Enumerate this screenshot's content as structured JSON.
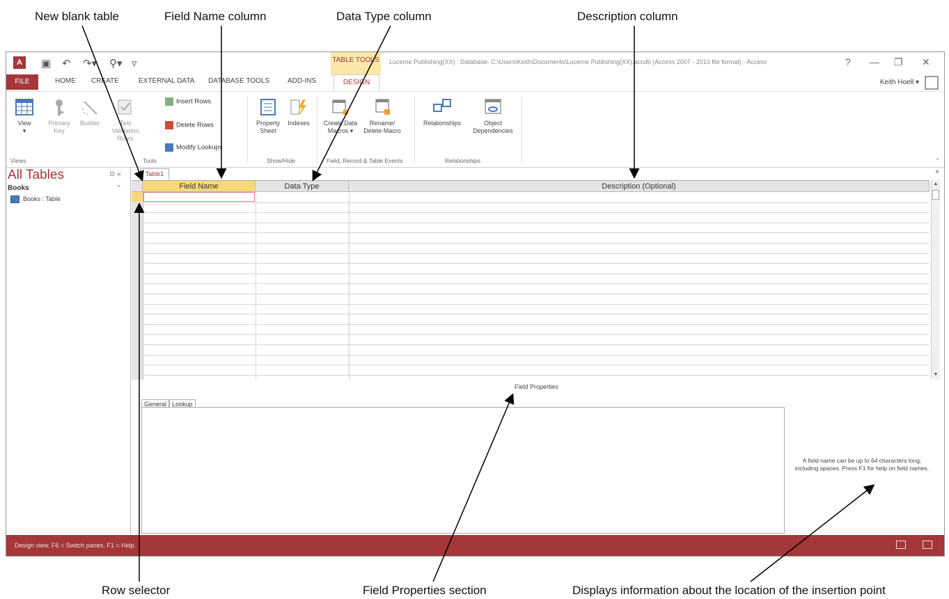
{
  "callouts": {
    "new_blank_table": "New blank table",
    "field_name_column": "Field Name column",
    "data_type_column": "Data Type column",
    "description_column": "Description column",
    "row_selector": "Row selector",
    "field_properties_section": "Field Properties section",
    "insertion_info": "Displays information about the location of the insertion point"
  },
  "window": {
    "table_tools_label": "TABLE TOOLS",
    "title": "Lucerne Publishing(XX) : Database- C:\\Users\\Keith\\Documents\\Lucerne Publishing(XX).accdb (Access 2007 - 2013 file format) - Access",
    "help": "?",
    "user": "Keith Hoell ▾"
  },
  "tabs": [
    "FILE",
    "HOME",
    "CREATE",
    "EXTERNAL DATA",
    "DATABASE TOOLS",
    "ADD-INS",
    "DESIGN"
  ],
  "ribbon": {
    "view": "View",
    "primary_key": "Primary Key",
    "builder": "Builder",
    "test_validation": "Test Validation Rules",
    "insert_rows": "Insert Rows",
    "delete_rows": "Delete Rows",
    "modify_lookups": "Modify Lookups",
    "property_sheet": "Property Sheet",
    "indexes": "Indexes",
    "create_data_macros": "Create Data Macros ▾",
    "rename_delete_macro": "Rename/ Delete Macro",
    "relationships": "Relationships",
    "object_dependencies": "Object Dependencies",
    "groups": {
      "views": "Views",
      "tools": "Tools",
      "show_hide": "Show/Hide",
      "events": "Field, Record & Table Events",
      "relationships": "Relationships"
    }
  },
  "nav": {
    "title": "All Tables",
    "controls": "⊙ «",
    "group": "Books",
    "item": "Books : Table"
  },
  "document": {
    "tab": "Table1",
    "close": "×",
    "headers": {
      "field_name": "Field Name",
      "data_type": "Data Type",
      "description": "Description (Optional)"
    }
  },
  "field_properties": {
    "label": "Field Properties",
    "tab_general": "General",
    "tab_lookup": "Lookup",
    "help_text": "A field name can be up to 64 characters long, including spaces. Press F1 for help on field names."
  },
  "status": {
    "message": "Design view.  F6 = Switch panes.  F1 = Help."
  },
  "colors": {
    "accent": "#a4373a",
    "active_header": "#f8d878"
  }
}
